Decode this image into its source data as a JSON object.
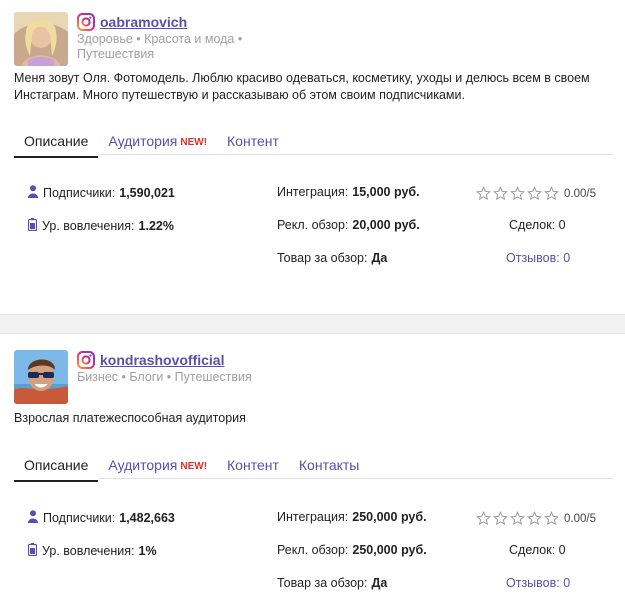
{
  "cards": [
    {
      "username": "oabramovich",
      "categories": "Здоровье • Красота и мода • Путешествия",
      "bio": "Меня зовут Оля. Фотомодель. Люблю красиво одеваться, косметику, уходы и делюсь всем в своем Инстаграм. Много путешествую и рассказываю об этом своим подписчиками.",
      "tabs": [
        {
          "label": "Описание",
          "active": true
        },
        {
          "label": "Аудитория",
          "badge": "NEW!"
        },
        {
          "label": "Контент"
        }
      ],
      "followers_label": "Подписчики:",
      "followers": "1,590,021",
      "engagement_label": "Ур. вовлечения:",
      "engagement": "1.22%",
      "integration_label": "Интеграция:",
      "integration": "15,000 руб.",
      "review_label": "Рекл. обзор:",
      "review": "20,000 руб.",
      "product_label": "Товар за обзор:",
      "product": "Да",
      "rating": "0.00/5",
      "deals": "Сделок: 0",
      "reviews": "Отзывов: 0"
    },
    {
      "username": "kondrashovofficial",
      "categories": "Бизнес • Блоги • Путешествия",
      "bio": "Взрослая платежеспособная аудитория",
      "tabs": [
        {
          "label": "Описание",
          "active": true
        },
        {
          "label": "Аудитория",
          "badge": "NEW!"
        },
        {
          "label": "Контент"
        },
        {
          "label": "Контакты"
        }
      ],
      "followers_label": "Подписчики:",
      "followers": "1,482,663",
      "engagement_label": "Ур. вовлечения:",
      "engagement": "1%",
      "integration_label": "Интеграция:",
      "integration": "250,000 руб.",
      "review_label": "Рекл. обзор:",
      "review": "250,000 руб.",
      "product_label": "Товар за обзор:",
      "product": "Да",
      "rating": "0.00/5",
      "deals": "Сделок: 0",
      "reviews": "Отзывов: 0"
    }
  ],
  "colors": {
    "accent": "#5a4fb0",
    "badge": "#e0302a",
    "muted": "#a0a0a0"
  },
  "icons": [
    "instagram-icon",
    "user-icon",
    "battery-icon",
    "star-icon"
  ]
}
